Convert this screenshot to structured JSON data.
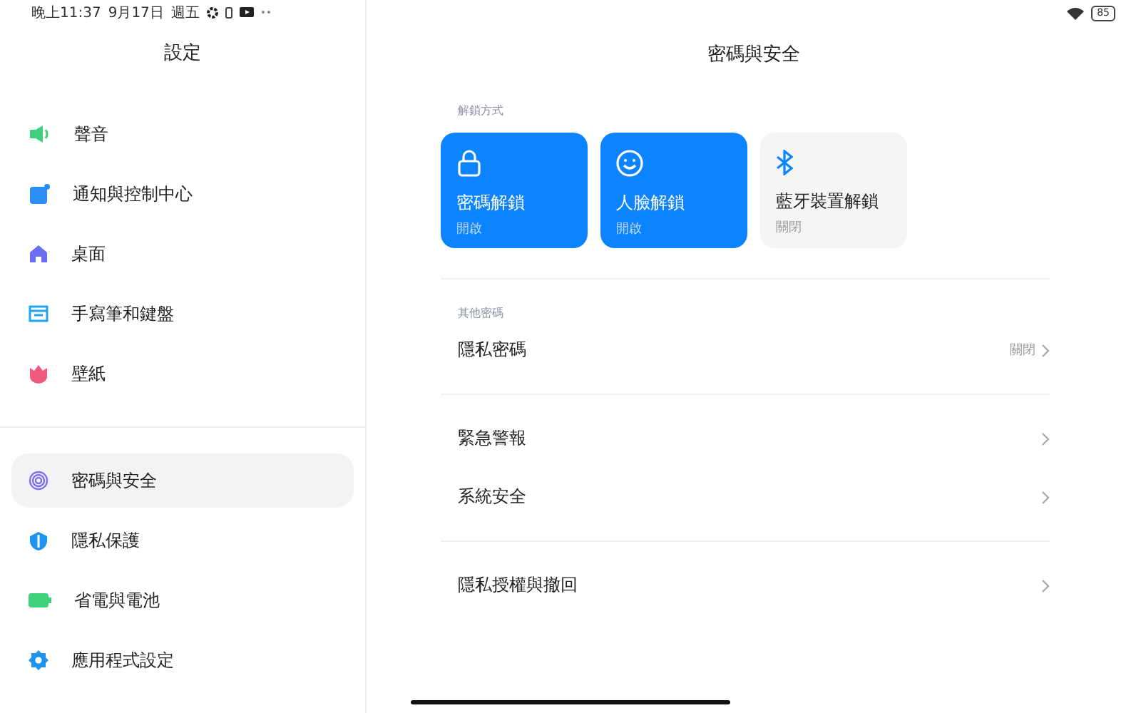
{
  "status_bar": {
    "time": "晚上11:37",
    "date": "9月17日",
    "weekday": "週五",
    "battery": "85"
  },
  "sidebar": {
    "title": "設定",
    "groups": [
      [
        {
          "label": "聲音",
          "kind": "sound",
          "selected": false
        },
        {
          "label": "通知與控制中心",
          "kind": "notification",
          "selected": false
        },
        {
          "label": "桌面",
          "kind": "home",
          "selected": false
        },
        {
          "label": "手寫筆和鍵盤",
          "kind": "keyboard",
          "selected": false
        },
        {
          "label": "壁紙",
          "kind": "wallpaper",
          "selected": false
        }
      ],
      [
        {
          "label": "密碼與安全",
          "kind": "fingerprint",
          "selected": true
        },
        {
          "label": "隱私保護",
          "kind": "privacy",
          "selected": false
        },
        {
          "label": "省電與電池",
          "kind": "battery",
          "selected": false
        },
        {
          "label": "應用程式設定",
          "kind": "gear",
          "selected": false
        }
      ]
    ]
  },
  "detail": {
    "title": "密碼與安全",
    "unlock_section": {
      "heading": "解鎖方式",
      "cards": [
        {
          "label": "密碼解鎖",
          "status": "開啟",
          "kind": "lock",
          "on": true
        },
        {
          "label": "人臉解鎖",
          "status": "開啟",
          "kind": "face",
          "on": true
        },
        {
          "label": "藍牙裝置解鎖",
          "status": "關閉",
          "kind": "bluetooth",
          "on": false
        }
      ]
    },
    "groups": [
      {
        "heading": "其他密碼",
        "rows": [
          {
            "label": "隱私密碼",
            "value": "關閉"
          }
        ]
      },
      {
        "rows": [
          {
            "label": "緊急警報"
          },
          {
            "label": "系統安全"
          }
        ]
      },
      {
        "rows": [
          {
            "label": "隱私授權與撤回"
          }
        ]
      }
    ]
  }
}
